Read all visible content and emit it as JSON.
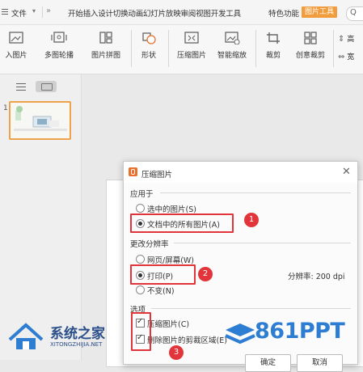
{
  "menubar": {
    "file": "文件",
    "items_text": "开始插入设计切换动画幻灯片放映审阅视图开发工具",
    "special": "特色功能",
    "picture_tools_tab": "图片工具"
  },
  "ribbon": {
    "tools": [
      {
        "label": "入图片"
      },
      {
        "label": "多图轮播"
      },
      {
        "label": "图片拼图"
      },
      {
        "label": "形状"
      },
      {
        "label": "压缩图片"
      },
      {
        "label": "智能缩放"
      },
      {
        "label": "裁剪"
      },
      {
        "label": "创意裁剪"
      }
    ],
    "right_top": "高",
    "right_bottom": "宽"
  },
  "slides": {
    "number": "1"
  },
  "dialog": {
    "title": "压缩图片",
    "apply_to": {
      "heading": "应用于",
      "options": [
        "选中的图片(S)",
        "文档中的所有图片(A)"
      ],
      "selected": 1
    },
    "resolution": {
      "heading": "更改分辨率",
      "options": [
        "网页/屏幕(W)",
        "打印(P)",
        "不变(N)"
      ],
      "selected": 1,
      "readout": "分辨率: 200 dpi"
    },
    "options": {
      "heading": "选项",
      "checkboxes": [
        {
          "label": "压缩图片(C)",
          "checked": true
        },
        {
          "label": "删除图片的剪裁区域(E)",
          "checked": true
        }
      ]
    },
    "buttons": [
      "确定",
      "取消"
    ]
  },
  "annotations": [
    "1",
    "2",
    "3"
  ],
  "watermarks": {
    "left_title": "系统之家",
    "left_sub": "XITONGZHIJIA.NET",
    "right_title": "861PPT"
  },
  "colors": {
    "accent": "#e8702a",
    "highlight_red": "#e2353b",
    "tab_orange": "#f29d3d",
    "watermark_blue": "#2d7dd2"
  }
}
